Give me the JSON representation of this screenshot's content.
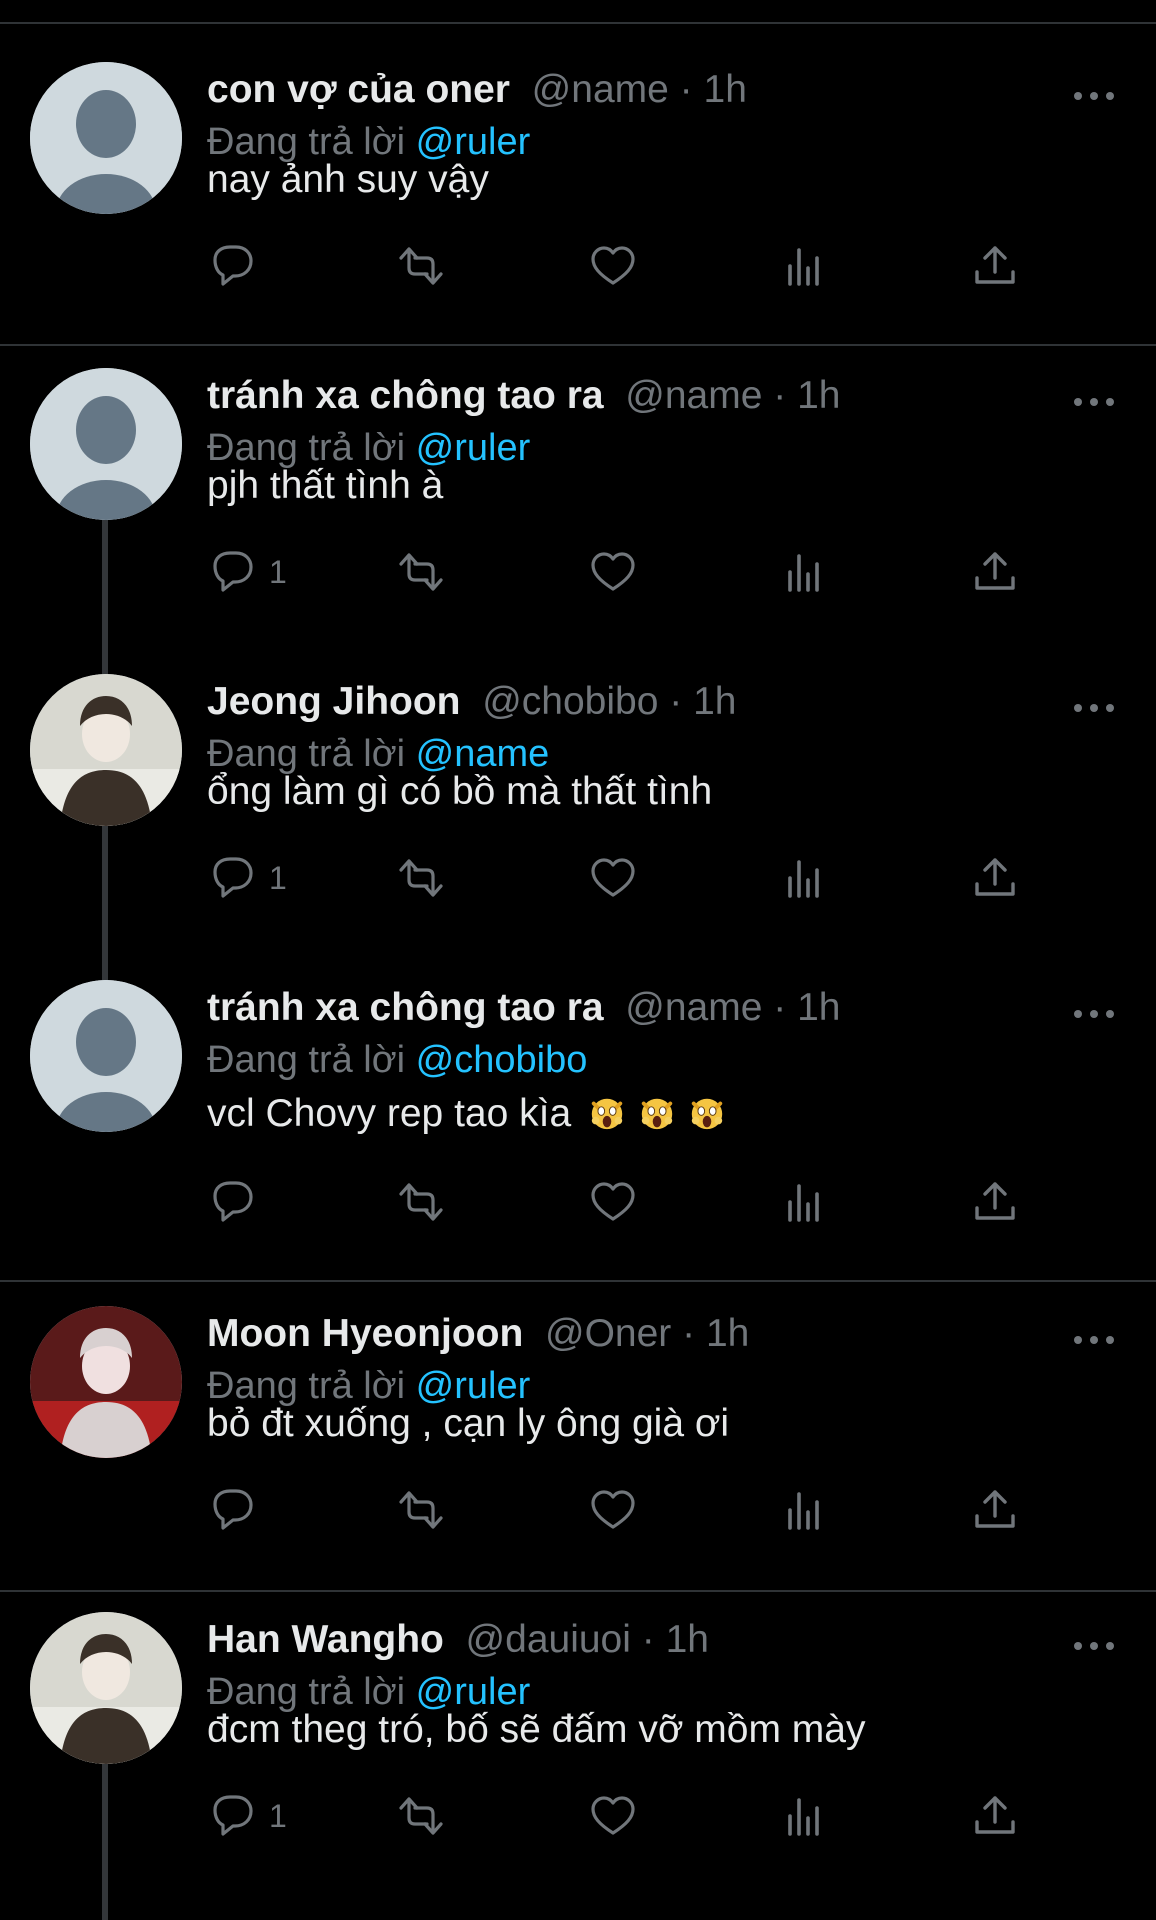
{
  "colors": {
    "background": "#000000",
    "text": "#e7e9ea",
    "muted": "#71767b",
    "mention": "#1d9bf0",
    "divider": "#2f3336"
  },
  "reply_prefix": "Đang trả lời",
  "separator_dot": "·",
  "tweets": [
    {
      "name": "con vợ của oner",
      "handle": "@name",
      "time": "1h",
      "reply_to": "@ruler",
      "text": "nay ảnh suy vậy",
      "replies": "",
      "avatar": "default-avatar"
    },
    {
      "name": "tránh xa chông tao ra",
      "handle": "@name",
      "time": "1h",
      "reply_to": "@ruler",
      "text": "pjh thất tình à",
      "replies": "1",
      "avatar": "default-avatar"
    },
    {
      "name": "Jeong Jihoon",
      "handle": "@chobibo",
      "time": "1h",
      "reply_to": "@name",
      "text": "ổng làm gì có bồ mà thất tình",
      "replies": "1",
      "avatar": "photo-avatar"
    },
    {
      "name": "tránh xa chông tao ra",
      "handle": "@name",
      "time": "1h",
      "reply_to": "@chobibo",
      "text": "vcl Chovy rep tao kìa",
      "emojis": "😱😱😱",
      "replies": "",
      "avatar": "default-avatar"
    },
    {
      "name": "Moon Hyeonjoon",
      "handle": "@Oner",
      "time": "1h",
      "reply_to": "@ruler",
      "text": "bỏ đt xuống , cạn ly ông già ơi",
      "replies": "",
      "avatar": "photo-avatar"
    },
    {
      "name": "Han Wangho",
      "handle": "@dauiuoi",
      "time": "1h",
      "reply_to": "@ruler",
      "text": "đcm theg tró, bố sẽ đấm vỡ mồm mày",
      "replies": "1",
      "avatar": "photo-avatar"
    }
  ],
  "action_icons": [
    "reply-icon",
    "retweet-icon",
    "like-icon",
    "views-icon",
    "share-icon"
  ]
}
